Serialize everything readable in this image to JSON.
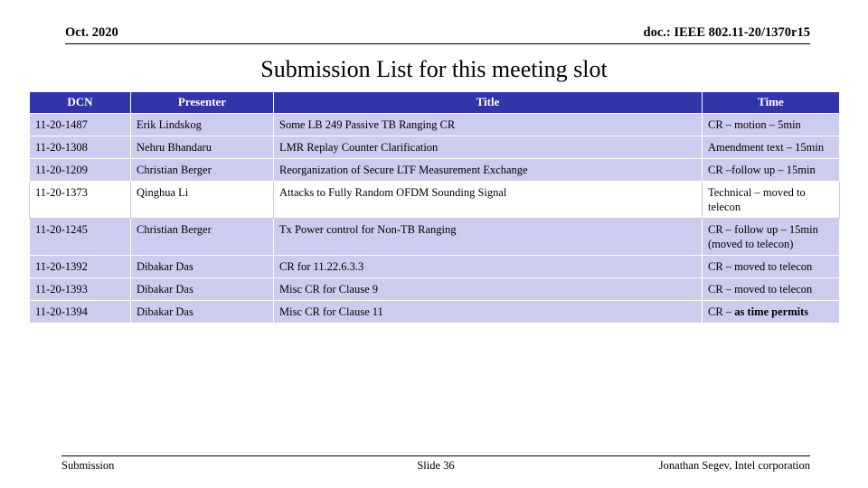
{
  "header": {
    "date": "Oct. 2020",
    "doc_id": "doc.: IEEE 802.11-20/1370r15"
  },
  "title": "Submission List for this meeting slot",
  "table": {
    "columns": [
      "DCN",
      "Presenter",
      "Title",
      "Time"
    ],
    "rows": [
      {
        "dcn": "11-20-1487",
        "presenter": "Erik Lindskog",
        "title": "Some LB 249 Passive TB Ranging CR",
        "time": "CR – motion – 5min",
        "shaded": true
      },
      {
        "dcn": "11-20-1308",
        "presenter": "Nehru Bhandaru",
        "title": "LMR Replay Counter Clarification",
        "time": "Amendment text – 15min",
        "shaded": true
      },
      {
        "dcn": "11-20-1209",
        "presenter": "Christian Berger",
        "title": "Reorganization of Secure LTF Measurement Exchange",
        "time": "CR –follow up – 15min",
        "shaded": true
      },
      {
        "dcn": "11-20-1373",
        "presenter": "Qinghua Li",
        "title": "Attacks to Fully Random OFDM Sounding Signal",
        "time": "Technical – moved to telecon",
        "shaded": false
      },
      {
        "dcn": "11-20-1245",
        "presenter": "Christian Berger",
        "title": "Tx Power control for Non-TB Ranging",
        "time": "CR – follow up – 15min (moved to telecon)",
        "shaded": true
      },
      {
        "dcn": "11-20-1392",
        "presenter": "Dibakar Das",
        "title": "CR for 11.22.6.3.3",
        "time": "CR – moved to telecon",
        "shaded": true
      },
      {
        "dcn": "11-20-1393",
        "presenter": "Dibakar Das",
        "title": "Misc CR for Clause 9",
        "time": "CR – moved to telecon",
        "shaded": true
      },
      {
        "dcn": "11-20-1394",
        "presenter": "Dibakar Das",
        "title": "Misc CR for Clause 11",
        "time_prefix": "CR – ",
        "time_bold": "as time permits",
        "time": "CR – as time permits",
        "shaded": true
      }
    ]
  },
  "footer": {
    "left": "Submission",
    "center": "Slide 36",
    "right": "Jonathan Segev, Intel corporation"
  },
  "colors": {
    "header_row": "#3333aa",
    "shaded_row": "#ccccee",
    "text": "#000000"
  }
}
